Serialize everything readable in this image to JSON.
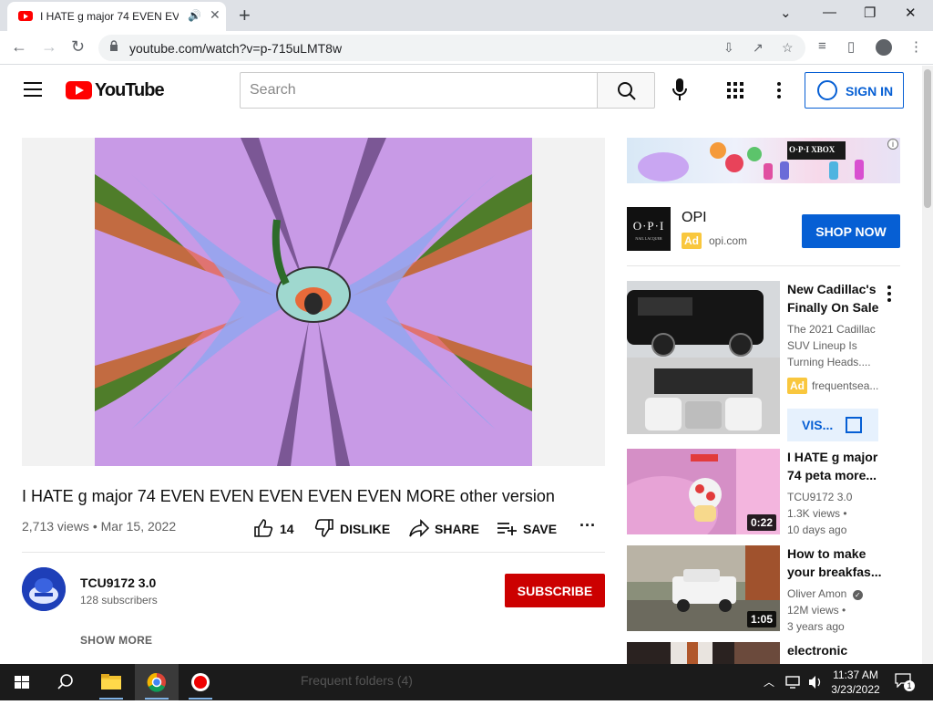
{
  "browser": {
    "tab_title": "I HATE g major 74 EVEN EVE",
    "url": "youtube.com/watch?v=p-715uLMT8w"
  },
  "youtube": {
    "logo_text": "YouTube",
    "search_placeholder": "Search",
    "signin_label": "SIGN IN"
  },
  "video": {
    "title": "I HATE g major 74 EVEN EVEN EVEN EVEN EVEN MORE other version",
    "views": "2,713 views",
    "date": "Mar 15, 2022",
    "likes": "14",
    "dislike_label": "DISLIKE",
    "share_label": "SHARE",
    "save_label": "SAVE"
  },
  "channel": {
    "name": "TCU9172 3.0",
    "subscribers": "128 subscribers",
    "subscribe_label": "SUBSCRIBE",
    "show_more_label": "SHOW MORE"
  },
  "ad": {
    "brand": "OPI",
    "logo_text": "O·P·I",
    "logo_subtext": "NAIL LACQUER",
    "badge": "Ad",
    "domain": "opi.com",
    "cta": "SHOP NOW",
    "banner_text": "O·P·I  XBOX"
  },
  "sidebar": {
    "promoted": {
      "title": "New Cadillac's Finally On Sale",
      "description": "The 2021 Cadillac SUV Lineup Is Turning Heads....",
      "badge": "Ad",
      "source": "frequentsea...",
      "cta": "VIS..."
    },
    "videos": [
      {
        "title": "I HATE g major 74 peta more...",
        "channel": "TCU9172 3.0",
        "views": "1.3K views •",
        "age": "10 days ago",
        "duration": "0:22"
      },
      {
        "title": "How to make your breakfas...",
        "channel": "Oliver Amon",
        "views": "12M views •",
        "age": "3 years ago",
        "duration": "1:05"
      },
      {
        "title": "electronic",
        "channel": "",
        "views": "",
        "age": "",
        "duration": ""
      }
    ]
  },
  "taskbar": {
    "time": "11:37 AM",
    "date": "3/23/2022",
    "notification_count": "1",
    "ghost_text": "Frequent folders (4)"
  },
  "colors": {
    "youtube_red": "#ff0000",
    "subscribe_red": "#cc0000",
    "link_blue": "#065fd4",
    "ad_yellow": "#f9c73e"
  }
}
